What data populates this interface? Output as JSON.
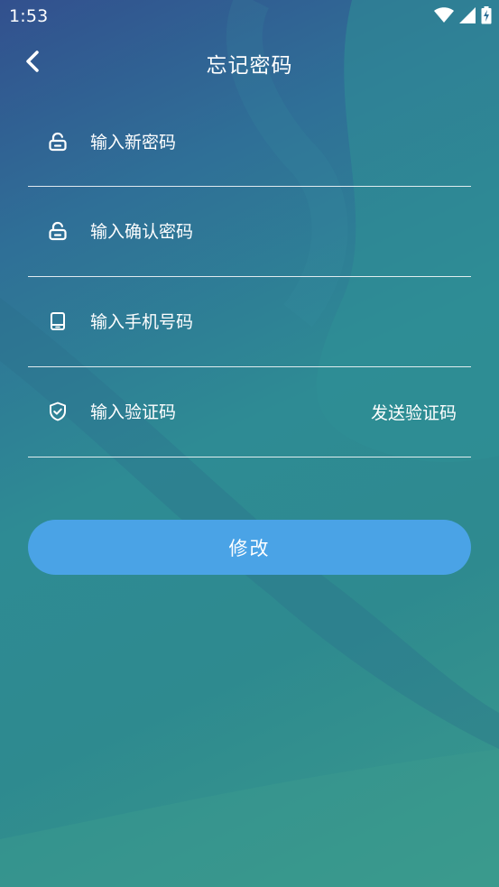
{
  "status_bar": {
    "time": "1:53",
    "icons": [
      "wifi-icon",
      "signal-icon",
      "battery-charging-icon"
    ]
  },
  "header": {
    "title": "忘记密码",
    "back_icon": "chevron-left-icon"
  },
  "form": {
    "new_password": {
      "placeholder": "输入新密码",
      "value": "",
      "icon": "unlock-icon"
    },
    "confirm_password": {
      "placeholder": "输入确认密码",
      "value": "",
      "icon": "unlock-icon"
    },
    "phone": {
      "placeholder": "输入手机号码",
      "value": "",
      "icon": "phone-icon"
    },
    "code": {
      "placeholder": "输入验证码",
      "value": "",
      "icon": "shield-check-icon"
    },
    "send_code_label": "发送验证码"
  },
  "submit_label": "修改",
  "colors": {
    "button": "#4aa3e6",
    "text": "#ffffff",
    "background_start": "#32508e",
    "background_end": "#3a9a8c"
  }
}
